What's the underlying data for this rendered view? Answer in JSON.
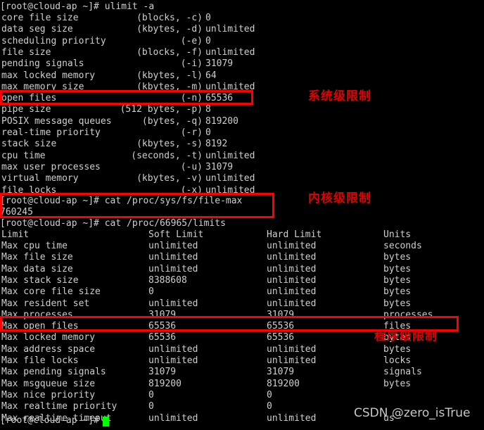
{
  "terminal": {
    "prompt": "[root@cloud-ap ~]# ",
    "commands": {
      "ulimit": "ulimit -a",
      "file_max": "cat /proc/sys/fs/file-max",
      "proc_limits": "cat /proc/66965/limits"
    },
    "file_max_value": "760245",
    "cursor": "block-cursor",
    "colors": {
      "background": "#000000",
      "text": "#cfcfcf",
      "cursor": "#00ff00",
      "annotation": "#e00000",
      "box": "#fe0000"
    }
  },
  "ulimit_output": [
    {
      "name": "core file size",
      "flag": "(blocks, -c)",
      "value": "0"
    },
    {
      "name": "data seg size",
      "flag": "(kbytes, -d)",
      "value": "unlimited"
    },
    {
      "name": "scheduling priority",
      "flag": "(-e)",
      "value": "0"
    },
    {
      "name": "file size",
      "flag": "(blocks, -f)",
      "value": "unlimited"
    },
    {
      "name": "pending signals",
      "flag": "(-i)",
      "value": "31079"
    },
    {
      "name": "max locked memory",
      "flag": "(kbytes, -l)",
      "value": "64"
    },
    {
      "name": "max memory size",
      "flag": "(kbytes, -m)",
      "value": "unlimited"
    },
    {
      "name": "open files",
      "flag": "(-n)",
      "value": "65536"
    },
    {
      "name": "pipe size",
      "flag": "(512 bytes, -p)",
      "value": "8"
    },
    {
      "name": "POSIX message queues",
      "flag": "(bytes, -q)",
      "value": "819200"
    },
    {
      "name": "real-time priority",
      "flag": "(-r)",
      "value": "0"
    },
    {
      "name": "stack size",
      "flag": "(kbytes, -s)",
      "value": "8192"
    },
    {
      "name": "cpu time",
      "flag": "(seconds, -t)",
      "value": "unlimited"
    },
    {
      "name": "max user processes",
      "flag": "(-u)",
      "value": "31079"
    },
    {
      "name": "virtual memory",
      "flag": "(kbytes, -v)",
      "value": "unlimited"
    },
    {
      "name": "file locks",
      "flag": "(-x)",
      "value": "unlimited"
    }
  ],
  "limits_table": {
    "headers": {
      "limit": "Limit",
      "soft": "Soft Limit",
      "hard": "Hard Limit",
      "units": "Units"
    },
    "rows": [
      {
        "limit": "Max cpu time",
        "soft": "unlimited",
        "hard": "unlimited",
        "units": "seconds"
      },
      {
        "limit": "Max file size",
        "soft": "unlimited",
        "hard": "unlimited",
        "units": "bytes"
      },
      {
        "limit": "Max data size",
        "soft": "unlimited",
        "hard": "unlimited",
        "units": "bytes"
      },
      {
        "limit": "Max stack size",
        "soft": "8388608",
        "hard": "unlimited",
        "units": "bytes"
      },
      {
        "limit": "Max core file size",
        "soft": "0",
        "hard": "unlimited",
        "units": "bytes"
      },
      {
        "limit": "Max resident set",
        "soft": "unlimited",
        "hard": "unlimited",
        "units": "bytes"
      },
      {
        "limit": "Max processes",
        "soft": "31079",
        "hard": "31079",
        "units": "processes"
      },
      {
        "limit": "Max open files",
        "soft": "65536",
        "hard": "65536",
        "units": "files"
      },
      {
        "limit": "Max locked memory",
        "soft": "65536",
        "hard": "65536",
        "units": "bytes"
      },
      {
        "limit": "Max address space",
        "soft": "unlimited",
        "hard": "unlimited",
        "units": "bytes"
      },
      {
        "limit": "Max file locks",
        "soft": "unlimited",
        "hard": "unlimited",
        "units": "locks"
      },
      {
        "limit": "Max pending signals",
        "soft": "31079",
        "hard": "31079",
        "units": "signals"
      },
      {
        "limit": "Max msgqueue size",
        "soft": "819200",
        "hard": "819200",
        "units": "bytes"
      },
      {
        "limit": "Max nice priority",
        "soft": "0",
        "hard": "0",
        "units": ""
      },
      {
        "limit": "Max realtime priority",
        "soft": "0",
        "hard": "0",
        "units": ""
      },
      {
        "limit": "Max realtime timeout",
        "soft": "unlimited",
        "hard": "unlimited",
        "units": "us"
      }
    ]
  },
  "annotations": [
    {
      "text": "系统级限制",
      "name": "annotation-system-level"
    },
    {
      "text": "内核级限制",
      "name": "annotation-kernel-level"
    },
    {
      "text": "程序级限制",
      "name": "annotation-process-level"
    }
  ],
  "watermark": {
    "text": "CSDN @zero_isTrue"
  }
}
